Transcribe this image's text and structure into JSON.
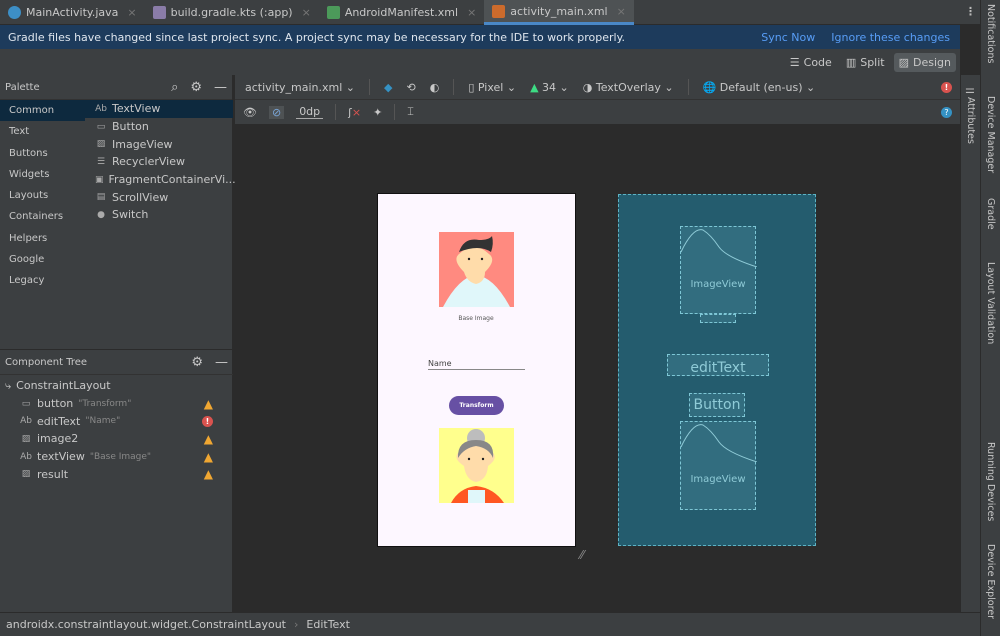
{
  "tabs": [
    {
      "label": "MainActivity.java",
      "color": "#3d8fc6"
    },
    {
      "label": "build.gradle.kts (:app)",
      "color": "#8a7ca8"
    },
    {
      "label": "AndroidManifest.xml",
      "color": "#4c9a5a"
    },
    {
      "label": "activity_main.xml",
      "color": "#cc6b2c",
      "active": true
    }
  ],
  "notice": {
    "text": "Gradle files have changed since last project sync. A project sync may be necessary for the IDE to work properly.",
    "sync": "Sync Now",
    "ignore": "Ignore these changes"
  },
  "view_modes": {
    "code": "Code",
    "split": "Split",
    "design": "Design",
    "selected": "Design"
  },
  "palette": {
    "title": "Palette",
    "categories": [
      "Common",
      "Text",
      "Buttons",
      "Widgets",
      "Layouts",
      "Containers",
      "Helpers",
      "Google",
      "Legacy"
    ],
    "items": [
      {
        "glyph": "Ab",
        "label": "TextView"
      },
      {
        "glyph": "▭",
        "label": "Button"
      },
      {
        "glyph": "▨",
        "label": "ImageView"
      },
      {
        "glyph": "☰",
        "label": "RecyclerView"
      },
      {
        "glyph": "▣",
        "label": "FragmentContainerVi..."
      },
      {
        "glyph": "▤",
        "label": "ScrollView"
      },
      {
        "glyph": "●",
        "label": "Switch"
      }
    ]
  },
  "tree": {
    "title": "Component Tree",
    "root": "ConstraintLayout",
    "nodes": [
      {
        "glyph": "▭",
        "name": "button",
        "hint": "\"Transform\"",
        "status": "warning"
      },
      {
        "glyph": "Ab",
        "name": "editText",
        "hint": "\"Name\"",
        "status": "error"
      },
      {
        "glyph": "▨",
        "name": "image2",
        "hint": "",
        "status": "warning"
      },
      {
        "glyph": "Ab",
        "name": "textView",
        "hint": "\"Base Image\"",
        "status": "warning"
      },
      {
        "glyph": "▨",
        "name": "result",
        "hint": "",
        "status": "warning"
      }
    ]
  },
  "toolbar": {
    "file": "activity_main.xml",
    "device": "Pixel",
    "api": "34",
    "theme": "TextOverlay",
    "locale": "Default (en-us)",
    "margin": "0dp"
  },
  "preview": {
    "base_caption": "Base Image",
    "name_hint": "Name",
    "button": "Transform",
    "button_color": "#6750a4"
  },
  "blueprint": {
    "image_label": "ImageView",
    "edit_label": "editText",
    "button_label": "Button"
  },
  "side": {
    "attributes": "Attributes",
    "notifications": "Notifications",
    "device_manager": "Device Manager",
    "gradle": "Gradle",
    "layout_validation": "Layout Validation",
    "running_devices": "Running Devices",
    "device_explorer": "Device Explorer"
  },
  "status": {
    "path": "androidx.constraintlayout.widget.ConstraintLayout",
    "current": "EditText"
  }
}
